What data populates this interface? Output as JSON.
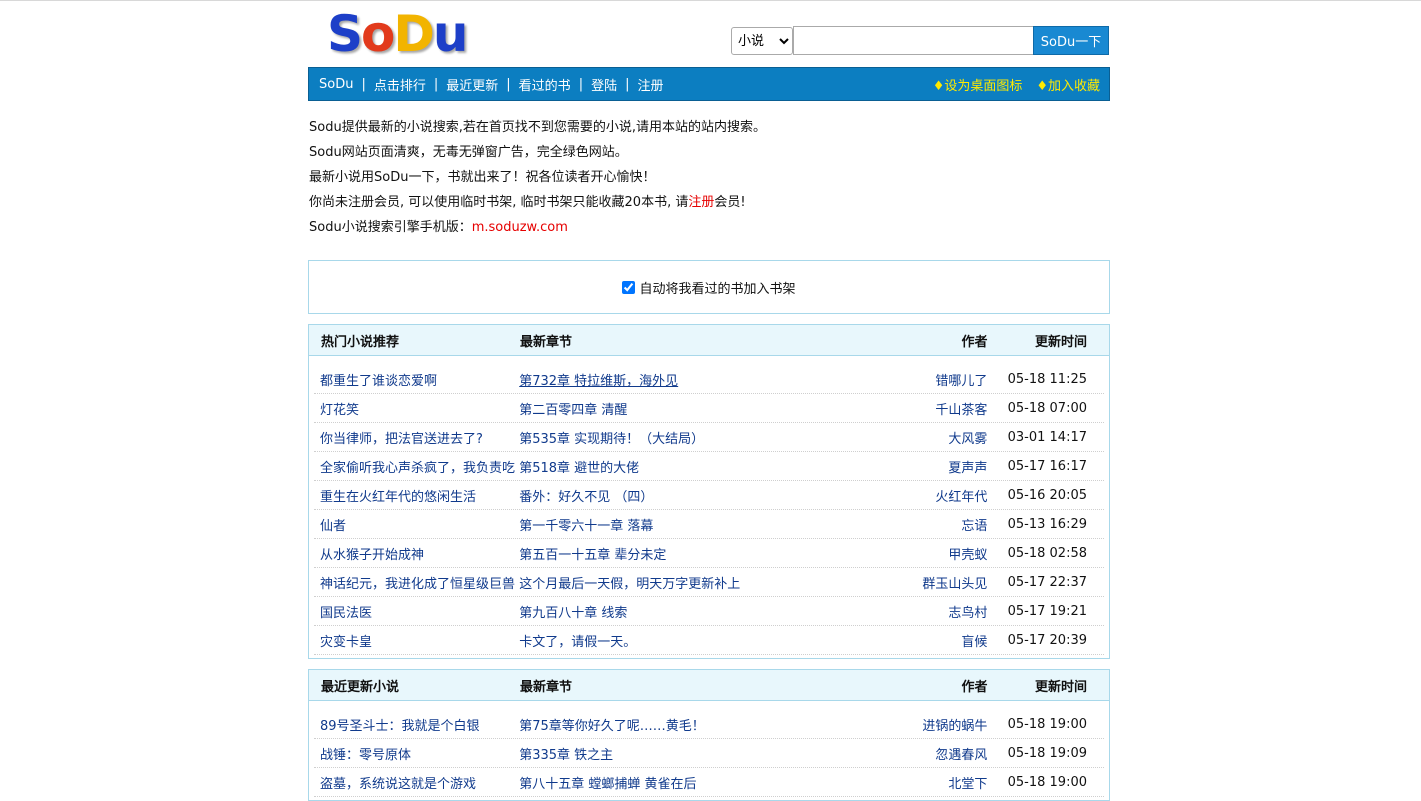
{
  "logo": {
    "letters": [
      "S",
      "o",
      "D",
      "u"
    ]
  },
  "search": {
    "category": "小说",
    "category_options": [
      "小说"
    ],
    "input_value": "",
    "button": "SoDu一下"
  },
  "nav": {
    "items": [
      "SoDu",
      "点击排行",
      "最近更新",
      "看过的书",
      "登陆",
      "注册"
    ],
    "separator": "|",
    "right": [
      "♦设为桌面图标",
      "♦加入收藏"
    ]
  },
  "info": {
    "line1": "Sodu提供最新的小说搜索,若在首页找不到您需要的小说,请用本站的站内搜索。",
    "line2": "Sodu网站页面清爽，无毒无弹窗广告，完全绿色网站。",
    "line3": "最新小说用SoDu一下，书就出来了！祝各位读者开心愉快！",
    "line4_pre": "你尚未注册会员, 可以使用临时书架, 临时书架只能收藏20本书, 请",
    "line4_link": "注册",
    "line4_post": "会员!",
    "line5_label": "Sodu小说搜索引擎手机版：",
    "line5_link": "m.soduzw.com"
  },
  "auto_add": {
    "label": "自动将我看过的书加入书架",
    "checked": true
  },
  "hot": {
    "headers": [
      "热门小说推荐",
      "最新章节",
      "作者",
      "更新时间"
    ],
    "rows": [
      [
        "都重生了谁谈恋爱啊",
        "第732章 特拉维斯，海外见",
        "错哪儿了",
        "05-18 11:25"
      ],
      [
        "灯花笑",
        "第二百零四章 清醒",
        "千山茶客",
        "05-18 07:00"
      ],
      [
        "你当律师，把法官送进去了?",
        "第535章 实现期待！（大结局）",
        "大风雾",
        "03-01 14:17"
      ],
      [
        "全家偷听我心声杀疯了，我负责吃",
        "第518章 避世的大佬",
        "夏声声",
        "05-17 16:17"
      ],
      [
        "重生在火红年代的悠闲生活",
        "番外：好久不见 （四）",
        "火红年代",
        "05-16 20:05"
      ],
      [
        "仙者",
        "第一千零六十一章 落幕",
        "忘语",
        "05-13 16:29"
      ],
      [
        "从水猴子开始成神",
        "第五百一十五章 辈分未定",
        "甲壳蚁",
        "05-18 02:58"
      ],
      [
        "神话纪元，我进化成了恒星级巨兽",
        "这个月最后一天假，明天万字更新补上",
        "群玉山头见",
        "05-17 22:37"
      ],
      [
        "国民法医",
        "第九百八十章 线索",
        "志鸟村",
        "05-17 19:21"
      ],
      [
        "灾变卡皇",
        "卡文了，请假一天。",
        "盲候",
        "05-17 20:39"
      ]
    ]
  },
  "recent": {
    "headers": [
      "最近更新小说",
      "最新章节",
      "作者",
      "更新时间"
    ],
    "rows": [
      [
        "89号圣斗士：我就是个白银",
        "第75章等你好久了呢……黄毛！",
        "进锅的蜗牛",
        "05-18 19:00"
      ],
      [
        "战锤：零号原体",
        "第335章 铁之主",
        "忽遇春风",
        "05-18 19:09"
      ],
      [
        "盗墓，系统说这就是个游戏",
        "第八十五章 螳螂捕蝉 黄雀在后",
        "北堂下",
        "05-18 19:00"
      ]
    ]
  }
}
